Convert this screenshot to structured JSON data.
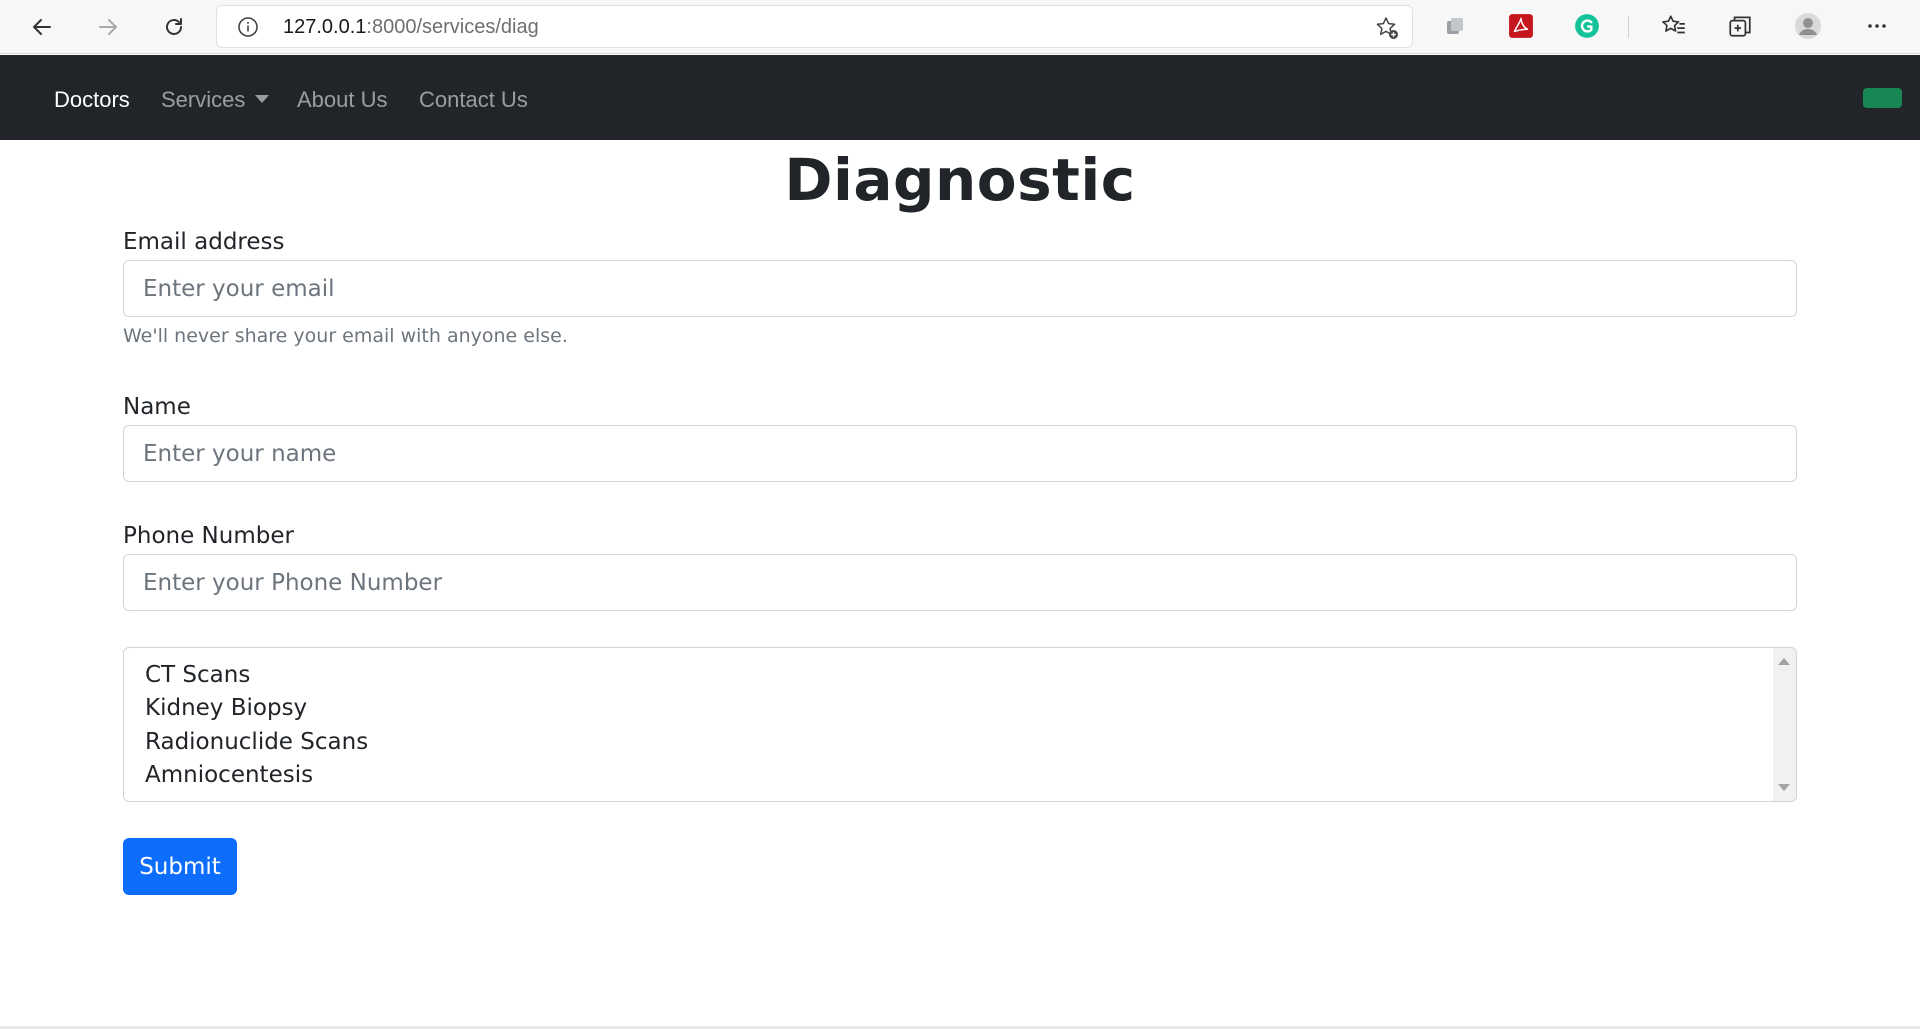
{
  "browser": {
    "url_host": "127.0.0.1",
    "url_rest": ":8000/services/diag"
  },
  "navbar": {
    "links": [
      {
        "label": "Doctors"
      },
      {
        "label": "Services"
      },
      {
        "label": "About Us"
      },
      {
        "label": "Contact Us"
      }
    ]
  },
  "page": {
    "title": "Diagnostic"
  },
  "form": {
    "email_label": "Email address",
    "email_placeholder": "Enter your email",
    "email_help": "We'll never share your email with anyone else.",
    "name_label": "Name",
    "name_placeholder": "Enter your name",
    "phone_label": "Phone Number",
    "phone_placeholder": "Enter your Phone Number",
    "services": [
      "CT Scans",
      "Kidney Biopsy",
      "Radionuclide Scans",
      "Amniocentesis"
    ],
    "submit_label": "Submit"
  },
  "colors": {
    "navbar_bg": "#212529",
    "primary": "#0d6efd",
    "success": "#198754"
  }
}
